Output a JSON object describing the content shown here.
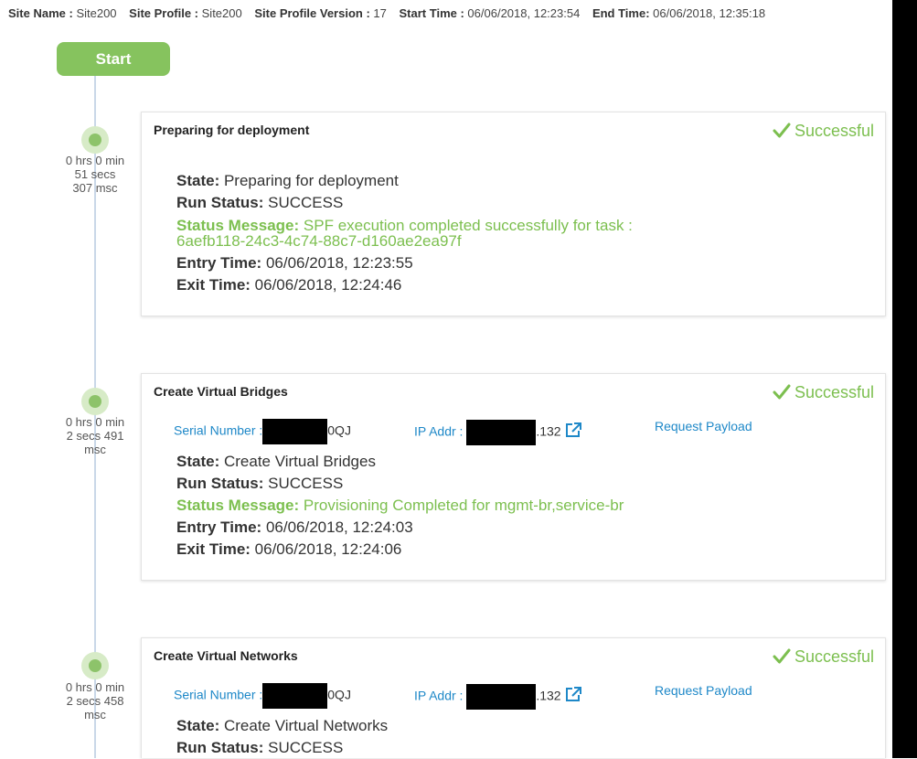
{
  "header": {
    "site_name_label": "Site Name :",
    "site_name": "Site200",
    "site_profile_label": "Site Profile :",
    "site_profile": "Site200",
    "site_profile_version_label": "Site Profile Version :",
    "site_profile_version": "17",
    "start_time_label": "Start Time :",
    "start_time": "06/06/2018, 12:23:54",
    "end_time_label": "End Time:",
    "end_time": "06/06/2018, 12:35:18"
  },
  "start_label": "Start",
  "colors": {
    "success": "#7cbf4f",
    "link": "#1e88c8",
    "start_button": "#86c35e"
  },
  "labels": {
    "state": "State:",
    "run_status": "Run Status:",
    "status_message": "Status Message:",
    "entry_time": "Entry Time:",
    "exit_time": "Exit Time:",
    "serial_number": "Serial Number :",
    "ip_addr": "IP Addr :",
    "request_payload": "Request Payload"
  },
  "steps": [
    {
      "title": "Preparing for deployment",
      "status": "Successful",
      "duration": [
        "0 hrs 0 min",
        "51 secs",
        "307 msc"
      ],
      "state": "Preparing for deployment",
      "run_status": "SUCCESS",
      "status_message": "SPF execution completed successfully for task : 6aefb118-24c3-4c74-88c7-d160ae2ea97f",
      "entry_time": "06/06/2018, 12:23:55",
      "exit_time": "06/06/2018, 12:24:46"
    },
    {
      "title": "Create Virtual Bridges",
      "status": "Successful",
      "duration": [
        "0 hrs 0 min",
        "2 secs 491",
        "msc"
      ],
      "serial_suffix": "0QJ",
      "ip_suffix": ".132",
      "state": "Create Virtual Bridges",
      "run_status": "SUCCESS",
      "status_message": "Provisioning Completed for mgmt-br,service-br",
      "entry_time": "06/06/2018, 12:24:03",
      "exit_time": "06/06/2018, 12:24:06"
    },
    {
      "title": "Create Virtual Networks",
      "status": "Successful",
      "duration": [
        "0 hrs 0 min",
        "2 secs 458",
        "msc"
      ],
      "serial_suffix": "0QJ",
      "ip_suffix": ".132",
      "state": "Create Virtual Networks",
      "run_status": "SUCCESS"
    }
  ]
}
